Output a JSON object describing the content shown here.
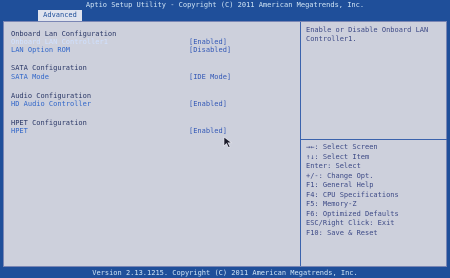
{
  "title": "Aptio Setup Utility - Copyright (C) 2011 American Megatrends, Inc.",
  "tab": "Advanced",
  "sections": [
    {
      "header": "Onboard Lan Configuration",
      "items": [
        {
          "label": "Onboard LAN Controller1",
          "value": "[Enabled]",
          "selected": true
        },
        {
          "label": "LAN Option ROM",
          "value": "[Disabled]"
        }
      ]
    },
    {
      "header": "SATA Configuration",
      "items": [
        {
          "label": "SATA Mode",
          "value": "[IDE Mode]"
        }
      ]
    },
    {
      "header": "Audio Configuration",
      "items": [
        {
          "label": "HD Audio Controller",
          "value": "[Enabled]"
        }
      ]
    },
    {
      "header": "HPET Configuration",
      "items": [
        {
          "label": "HPET",
          "value": "[Enabled]"
        }
      ]
    }
  ],
  "help_text": "Enable or Disable Onboard LAN Controller1.",
  "key_help": [
    "→←: Select Screen",
    "↑↓: Select Item",
    "Enter: Select",
    "+/-: Change Opt.",
    "F1: General Help",
    "F4: CPU Specifications",
    "F5: Memory-Z",
    "F6: Optimized Defaults",
    "ESC/Right Click: Exit",
    "F10: Save & Reset"
  ],
  "footer": "Version 2.13.1215. Copyright (C) 2011 American Megatrends, Inc."
}
